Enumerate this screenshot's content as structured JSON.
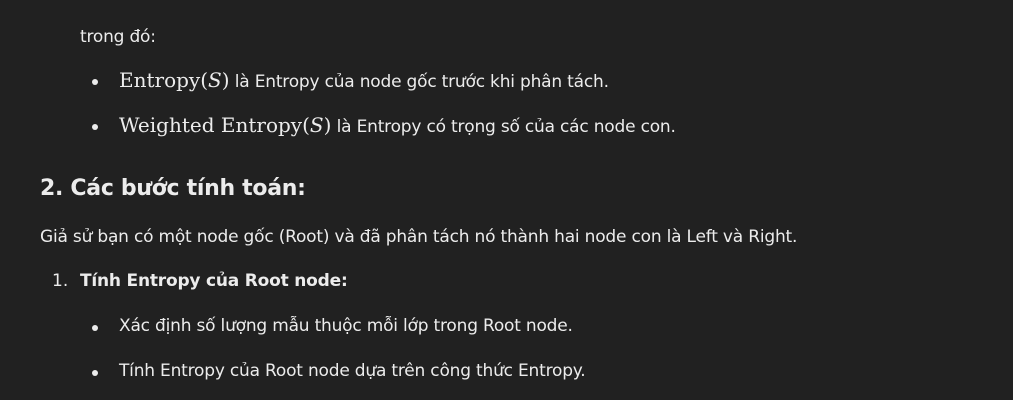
{
  "intro": {
    "text": "trong đó:"
  },
  "definitions": [
    {
      "math_name": "Entropy",
      "math_open": "(",
      "math_var": "S",
      "math_close": ")",
      "text": " là Entropy của node gốc trước khi phân tách."
    },
    {
      "math_name": "Weighted Entropy",
      "math_open": "(",
      "math_var": "S",
      "math_close": ")",
      "text": " là Entropy có trọng số của các node con."
    }
  ],
  "section": {
    "heading": "2. Các bước tính toán:"
  },
  "paragraph": {
    "text": "Giả sử bạn có một node gốc (Root) và đã phân tách nó thành hai node con là Left và Right."
  },
  "steps": [
    {
      "number": "1.",
      "title": "Tính Entropy của Root node:"
    }
  ],
  "substeps": [
    {
      "text": "Xác định số lượng mẫu thuộc mỗi lớp trong Root node."
    },
    {
      "text": "Tính Entropy của Root node dựa trên công thức Entropy."
    }
  ]
}
